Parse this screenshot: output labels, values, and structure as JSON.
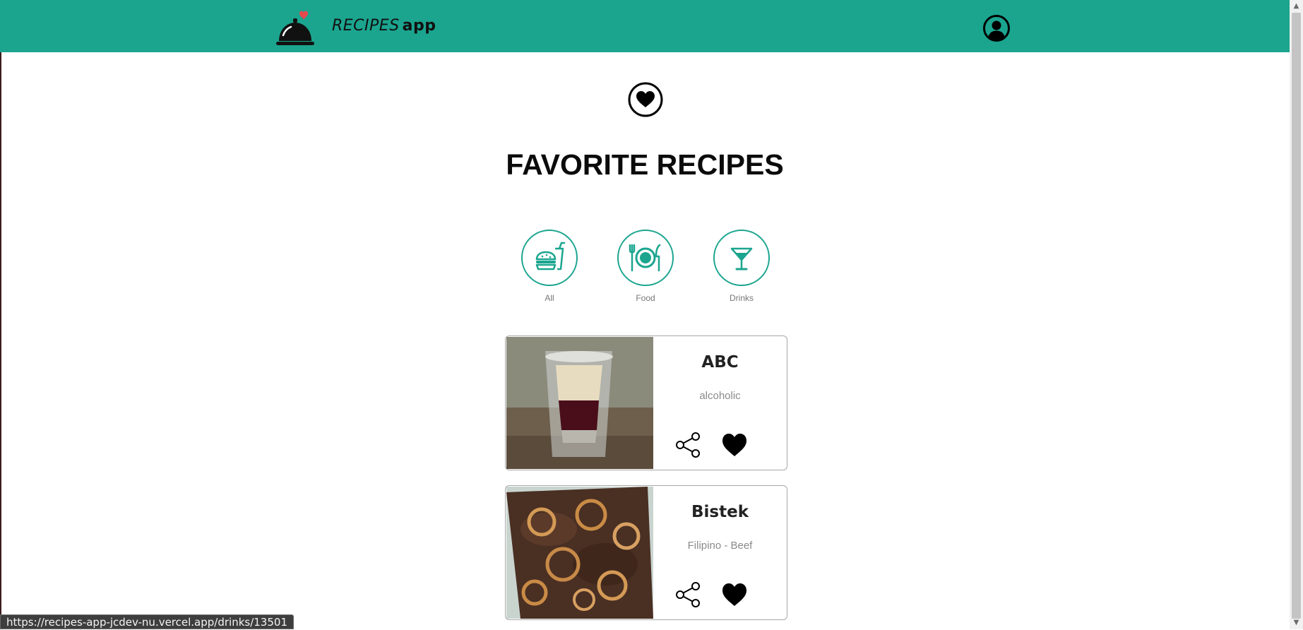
{
  "header": {
    "title_word1": "RECIPES",
    "title_word2": "app",
    "logo_icon": "cloche-heart-icon",
    "profile_icon": "user-circle-icon",
    "background_color": "#1ba58f"
  },
  "page": {
    "icon": "heart-circle-icon",
    "title": "FAVORITE RECIPES"
  },
  "filters": [
    {
      "label": "All",
      "icon": "burger-drink-icon"
    },
    {
      "label": "Food",
      "icon": "plate-cutlery-icon"
    },
    {
      "label": "Drinks",
      "icon": "cocktail-icon"
    }
  ],
  "cards": [
    {
      "name": "ABC",
      "category": "alcoholic",
      "image": "layered-shot-drink"
    },
    {
      "name": "Bistek",
      "category": "Filipino - Beef",
      "image": "beef-with-onion-rings"
    }
  ],
  "status_bar": {
    "url": "https://recipes-app-jcdev-nu.vercel.app/drinks/13501"
  },
  "colors": {
    "accent": "#1ba58f",
    "text": "#111111",
    "muted": "#8a8a8a",
    "heart_logo": "#e8484c"
  }
}
